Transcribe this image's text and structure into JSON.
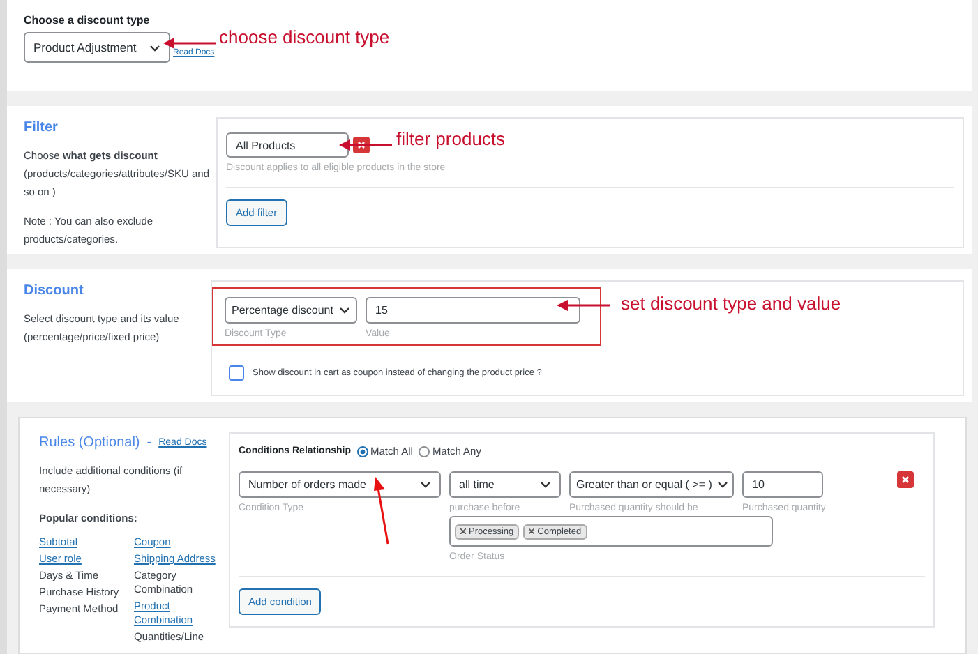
{
  "discount_type": {
    "heading": "Choose a discount type",
    "value": "Product Adjustment",
    "link": "Read Docs"
  },
  "filter": {
    "title": "Filter",
    "description": "Choose **what gets discount** (products/categories/attributes/SKU and so on )",
    "note": "Note : You can also exclude products/categories.",
    "select": "All Products",
    "hint": "Discount applies to all eligible products in the store",
    "add_button": "Add filter"
  },
  "discount": {
    "title": "Discount",
    "description": "Select discount type and its value (percentage/price/fixed price)",
    "type_value": "Percentage discount",
    "type_label": "Discount Type",
    "value": "15",
    "value_label": "Value",
    "coupon": {
      "label": "Show discount in cart as coupon instead of changing the product price ?",
      "checked": false
    }
  },
  "rules": {
    "title": "Rules (Optional)",
    "separator": "-",
    "link": "Read Docs",
    "description": "Include additional conditions (if necessary)",
    "popular_heading": "Popular conditions:",
    "popular_columns": [
      [
        {
          "label": "Subtotal",
          "link": true
        },
        {
          "label": "User role",
          "link": true
        },
        {
          "label": "Days & Time",
          "link": false
        },
        {
          "label": "Purchase History",
          "link": false
        },
        {
          "label": "Payment Method",
          "link": false
        }
      ],
      [
        {
          "label": "Coupon",
          "link": true
        },
        {
          "label": "Shipping Address",
          "link": true
        },
        {
          "label": "Category Combination",
          "link": false
        },
        {
          "label": "Product Combination",
          "link": true
        },
        {
          "label": "Quantities/Line",
          "link": false
        }
      ]
    ],
    "relationship_label": "Conditions Relationship",
    "radios": [
      {
        "label": "Match All",
        "selected": true
      },
      {
        "label": "Match Any",
        "selected": false
      }
    ],
    "condition": {
      "type": "Number of orders made",
      "type_label": "Condition Type",
      "period": "all time",
      "period_label": "purchase before",
      "operator": "Greater than or equal ( >= )",
      "operator_label": "Purchased quantity should be",
      "quantity": "10",
      "quantity_label": "Purchased quantity",
      "statuses": [
        "Processing",
        "Completed"
      ],
      "status_label": "Order Status"
    },
    "add_button": "Add condition"
  },
  "annotations": [
    "choose discount type",
    "filter products",
    "set discount type and value"
  ]
}
